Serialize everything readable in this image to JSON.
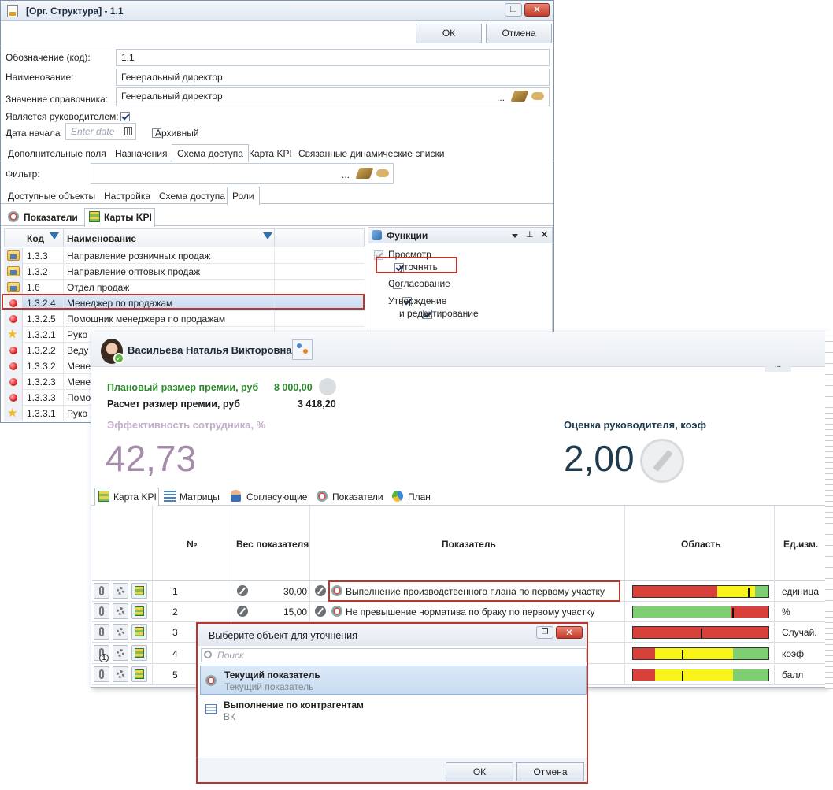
{
  "org_window": {
    "title": "[Орг. Структура] - 1.1",
    "ok_label": "ОК",
    "cancel_label": "Отмена",
    "fields": {
      "code_label": "Обозначение (код):",
      "code_value": "1.1",
      "name_label": "Наименование:",
      "name_value": "Генеральный директор",
      "ref_label": "Значение справочника:",
      "ref_value": "Генеральный директор",
      "ellipsis": "...",
      "is_head_label": "Является руководителем:",
      "start_date_label": "Дата начала",
      "start_date_placeholder": "Enter date",
      "archive_label": "Архивный"
    },
    "tabs": [
      "Дополнительные поля",
      "Назначения",
      "Схема доступа",
      "Карта KPI",
      "Связанные динамические списки"
    ],
    "filter_label": "Фильтр:",
    "subtabs": [
      "Доступные объекты",
      "Настройка",
      "Схема доступа",
      "Роли"
    ],
    "view_tabs": [
      "Показатели",
      "Карты KPI"
    ],
    "grid_headers": {
      "code": "Код",
      "name": "Наименование"
    },
    "grid_rows": [
      {
        "icon": "folder",
        "code": "1.3.3",
        "name": "Направление розничных продаж"
      },
      {
        "icon": "folder",
        "code": "1.3.2",
        "name": "Направление оптовых продаж"
      },
      {
        "icon": "folder",
        "code": "1.6",
        "name": "Отдел продаж"
      },
      {
        "icon": "dot",
        "code": "1.3.2.4",
        "name": "Менеджер по продажам"
      },
      {
        "icon": "dot",
        "code": "1.3.2.5",
        "name": "Помощник менеджера по продажам"
      },
      {
        "icon": "star",
        "code": "1.3.2.1",
        "name": "Руко"
      },
      {
        "icon": "dot",
        "code": "1.3.2.2",
        "name": "Веду"
      },
      {
        "icon": "dot",
        "code": "1.3.3.2",
        "name": "Мене"
      },
      {
        "icon": "dot",
        "code": "1.3.2.3",
        "name": "Мене"
      },
      {
        "icon": "dot",
        "code": "1.3.3.3",
        "name": "Помо"
      },
      {
        "icon": "star",
        "code": "1.3.3.1",
        "name": "Руко"
      }
    ],
    "functions_panel": {
      "title": "Функции",
      "items": [
        {
          "label": "Просмотр",
          "checked": true,
          "disabled": true
        },
        {
          "label": "уточнять",
          "checked": true,
          "disabled": false
        },
        {
          "label": "Согласование",
          "checked": false,
          "disabled": false
        },
        {
          "label": "Утверждение",
          "checked": true,
          "disabled": false
        },
        {
          "label": "и редактирование",
          "checked": true,
          "disabled": false
        }
      ]
    }
  },
  "kpi_card": {
    "person_name": "Васильева Наталья Викторовна",
    "more": "...",
    "planned_bonus_label": "Плановый размер премии, руб",
    "planned_bonus_value": "8 000,00",
    "calc_bonus_label": "Расчет размер премии, руб",
    "calc_bonus_value": "3 418,20",
    "efficiency_label": "Эффективность сотрудника, %",
    "efficiency_value": "42,73",
    "manager_score_label": "Оценка руководителя, коэф",
    "manager_score_value": "2,00",
    "tabs": [
      "Карта KPI",
      "Матрицы",
      "Согласующие",
      "Показатели",
      "План"
    ],
    "headers": {
      "num": "№",
      "weight": "Вес показателя",
      "indicator": "Показатель",
      "area": "Область",
      "unit": "Ед.изм."
    },
    "rows": [
      {
        "num": "1",
        "weight": "30,00",
        "indicator": "Выполнение производственного плана по первому участку",
        "unit": "единица",
        "badge": "",
        "bar": [
          0.62,
          0.28,
          0.1
        ],
        "mark": 0.85
      },
      {
        "num": "2",
        "weight": "15,00",
        "indicator": "Не превышение норматива по браку по первому участку",
        "unit": "%",
        "badge": "",
        "bar": [
          0.0,
          0.0,
          0.0
        ],
        "mark": 0.73
      },
      {
        "num": "3",
        "weight": "",
        "indicator": "",
        "unit": "Случай.",
        "badge": "",
        "bar": [
          1.0,
          0.0,
          0.0
        ],
        "mark": 0.5
      },
      {
        "num": "4",
        "weight": "",
        "indicator": "",
        "unit": "коэф",
        "badge": "1",
        "bar": [
          0.16,
          0.58,
          0.26
        ],
        "mark": 0.36
      },
      {
        "num": "5",
        "weight": "",
        "indicator": "",
        "unit": "балл",
        "badge": "",
        "bar": [
          0.16,
          0.58,
          0.26
        ],
        "mark": 0.36
      }
    ]
  },
  "select_dialog": {
    "title": "Выберите объект для уточнения",
    "search_placeholder": "Поиск",
    "items": [
      {
        "title": "Текущий показатель",
        "subtitle": "Текущий показатель"
      },
      {
        "title": "Выполнение по контрагентам",
        "subtitle": "ВК"
      }
    ],
    "ok_label": "ОК",
    "cancel_label": "Отмена"
  }
}
